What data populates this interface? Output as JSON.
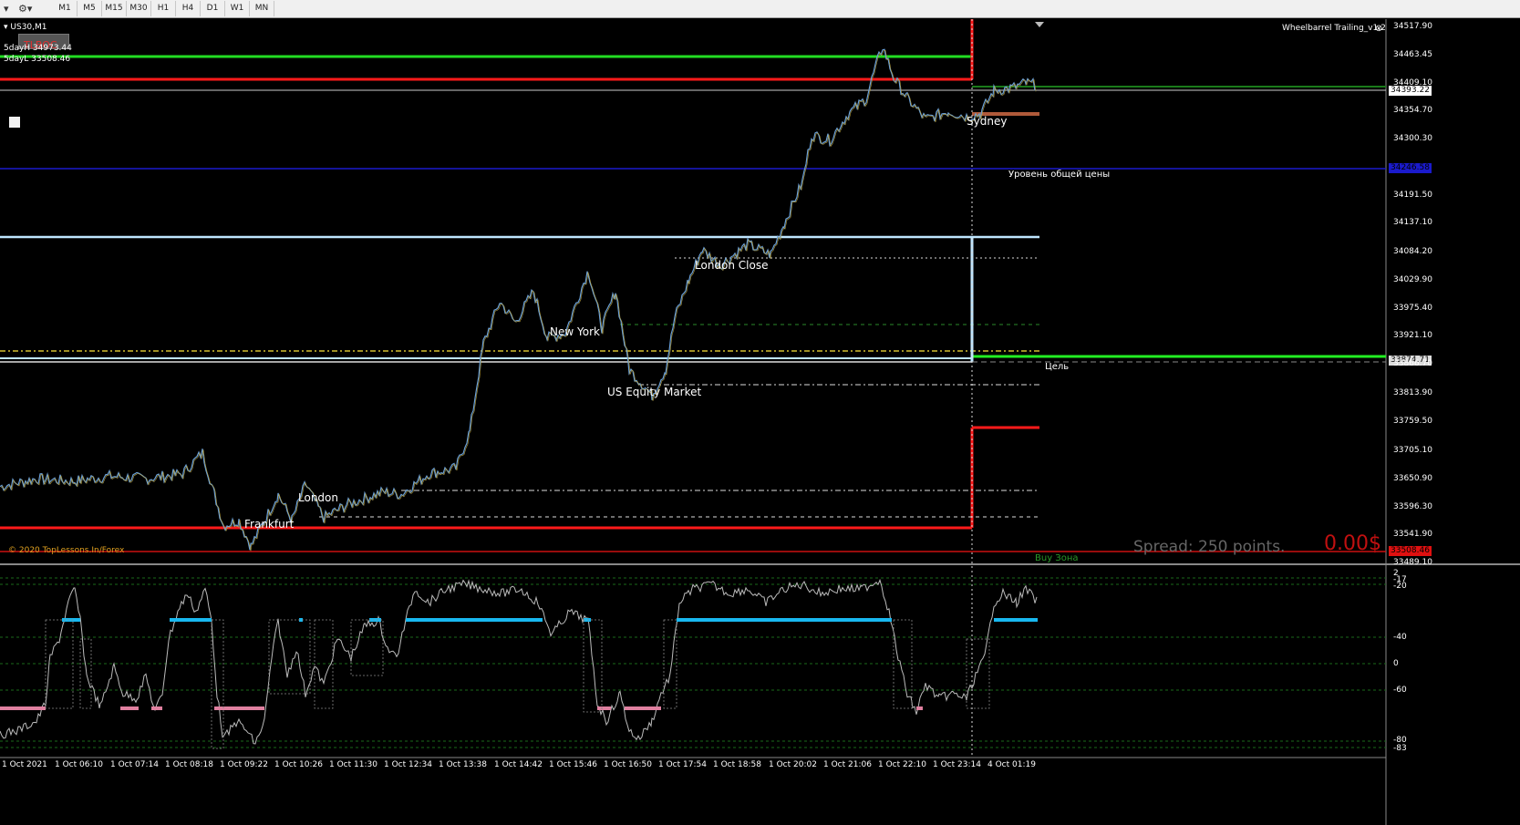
{
  "toolbar": {
    "timeframes": [
      "M1",
      "M5",
      "M15",
      "M30",
      "H1",
      "H4",
      "D1",
      "W1",
      "MN"
    ]
  },
  "chart": {
    "symbol": "US30,M1",
    "badge": "TLBOC",
    "five_day_high": "5dayH 34973.44",
    "five_day_low": "5dayL 33508.46",
    "indicator_name": "Wheelbarrel Trailing_v1.2",
    "copyright": "© 2020 TopLessons.In/Forex",
    "spread": "Spread: 250 points.",
    "profit": "0.00$",
    "labels": {
      "sydney": "Sydney",
      "common_price": "Уровень общей цены",
      "london_close": "London Close",
      "new_york": "New York",
      "us_equity": "US Equity Market",
      "target": "Цель",
      "london": "London",
      "frankfurt": "Frankfurt",
      "buy_zone": "Buy Зона"
    },
    "price_tags": {
      "current": "34393.22",
      "blue": "34246.58",
      "green": "33874.71",
      "red": "33508.46"
    }
  },
  "chart_data": {
    "type": "line",
    "price_axis": [
      "34517.90",
      "34463.45",
      "34409.10",
      "34354.70",
      "34300.30",
      "34191.50",
      "34137.10",
      "34084.20",
      "34029.90",
      "33975.40",
      "33921.10",
      "33866.70",
      "33813.90",
      "33759.50",
      "33705.10",
      "33650.90",
      "33596.30",
      "33541.90",
      "33489.10"
    ],
    "time_axis": [
      "1 Oct 2021",
      "1 Oct 06:10",
      "1 Oct 07:14",
      "1 Oct 08:18",
      "1 Oct 09:22",
      "1 Oct 10:26",
      "1 Oct 11:30",
      "1 Oct 12:34",
      "1 Oct 13:38",
      "1 Oct 14:42",
      "1 Oct 15:46",
      "1 Oct 16:50",
      "1 Oct 17:54",
      "1 Oct 18:58",
      "1 Oct 20:02",
      "1 Oct 21:06",
      "1 Oct 22:10",
      "1 Oct 23:14",
      "4 Oct 01:19"
    ],
    "osc_axis": [
      "2",
      "-17",
      "-20",
      "-40",
      "0",
      "-60",
      "-80",
      "-83"
    ],
    "x": [
      "1 Oct 2021",
      "1 Oct 06:10",
      "1 Oct 07:14",
      "1 Oct 08:18",
      "1 Oct 09:22",
      "1 Oct 10:26",
      "1 Oct 11:30",
      "1 Oct 12:34",
      "1 Oct 13:38",
      "1 Oct 14:42",
      "1 Oct 15:46",
      "1 Oct 16:50",
      "1 Oct 17:54",
      "1 Oct 18:58",
      "1 Oct 20:02",
      "1 Oct 21:06",
      "1 Oct 22:10",
      "1 Oct 23:14",
      "4 Oct 01:19"
    ],
    "price": [
      33650,
      33660,
      33655,
      33670,
      33600,
      33640,
      33610,
      33640,
      33680,
      33970,
      33960,
      33840,
      34050,
      34070,
      34190,
      34330,
      34370,
      34340,
      34400
    ],
    "ylim": [
      33489.1,
      34517.9
    ],
    "levels": [
      34463.45,
      34437.0,
      34246.58,
      34099.0,
      33874.71,
      33508.46
    ]
  }
}
